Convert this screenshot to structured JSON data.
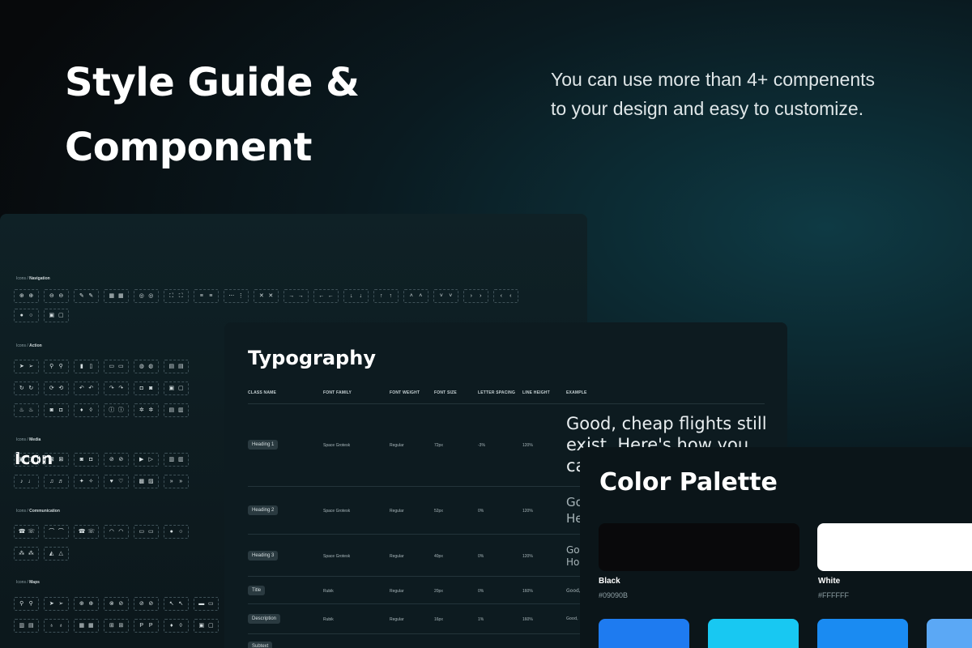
{
  "hero": {
    "title_line1": "Style Guide &",
    "title_line2": "Component",
    "description": "You can use more than 4+ compenents to your design and easy to customize."
  },
  "icon_panel": {
    "title": "Icon",
    "groups": [
      {
        "prefix": "Icons / ",
        "name": "Navigation"
      },
      {
        "prefix": "Icons / ",
        "name": "Action"
      },
      {
        "prefix": "Icons / ",
        "name": "Media"
      },
      {
        "prefix": "Icons / ",
        "name": "Communication"
      },
      {
        "prefix": "Icons / ",
        "name": "Maps"
      }
    ]
  },
  "typography_panel": {
    "title": "Typography",
    "headers": [
      "CLASS NAME",
      "FONT FAMILY",
      "FONT WEIGHT",
      "FONT SIZE",
      "LETTER SPACING",
      "LINE HEIGHT",
      "EXAMPLE"
    ],
    "rows": [
      {
        "class": "Heading 1",
        "family": "Space Grotesk",
        "weight": "Regular",
        "size": "72px",
        "spacing": "-3%",
        "line": "120%",
        "example_l1": "Good, cheap flights still",
        "example_l2": "exist. Here's how you",
        "example_l3": "ca"
      },
      {
        "class": "Heading 2",
        "family": "Space Grotesk",
        "weight": "Regular",
        "size": "52px",
        "spacing": "0%",
        "line": "120%",
        "example_l1": "Go",
        "example_l2": "He"
      },
      {
        "class": "Heading 3",
        "family": "Space Grotesk",
        "weight": "Regular",
        "size": "40px",
        "spacing": "0%",
        "line": "120%",
        "example_l1": "Go",
        "example_l2": "Ho"
      },
      {
        "class": "Title",
        "family": "Rubik",
        "weight": "Regular",
        "size": "20px",
        "spacing": "0%",
        "line": "160%",
        "example_l1": "Good,"
      },
      {
        "class": "Description",
        "family": "Rubik",
        "weight": "Regular",
        "size": "16px",
        "spacing": "1%",
        "line": "160%",
        "example_l1": "Good, "
      },
      {
        "class": "Subtext",
        "family": "",
        "weight": "",
        "size": "",
        "spacing": "",
        "line": "",
        "example_l1": ""
      }
    ]
  },
  "color_panel": {
    "title": "Color Palette",
    "swatches": [
      {
        "name": "Black",
        "hex": "#09090B",
        "color": "#09090B"
      },
      {
        "name": "White",
        "hex": "#FFFFFF",
        "color": "#FFFFFF"
      },
      {
        "name": "",
        "hex": "",
        "color": "#1E7BF0"
      },
      {
        "name": "",
        "hex": "",
        "color": "#18C8F2"
      },
      {
        "name": "",
        "hex": "",
        "color": "#1A8BF2"
      },
      {
        "name": "",
        "hex": "",
        "color": "#5BA8F5"
      }
    ]
  }
}
